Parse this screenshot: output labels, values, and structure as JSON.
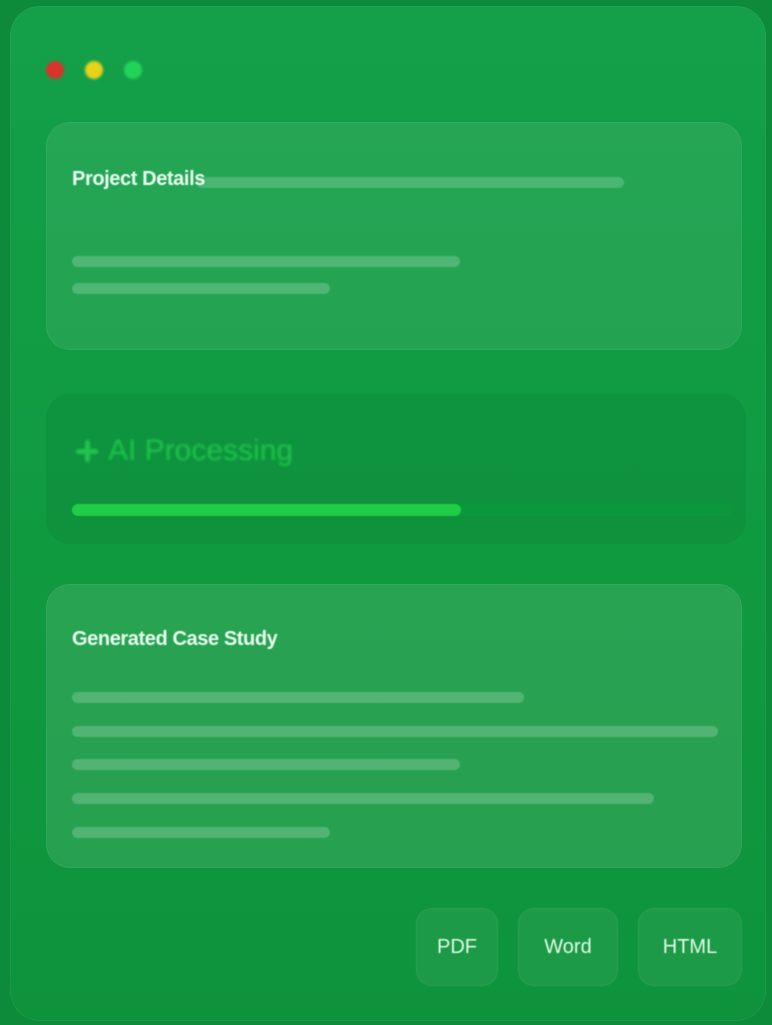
{
  "window": {
    "controls": [
      {
        "name": "close",
        "color": "#d8342a"
      },
      {
        "name": "minimize",
        "color": "#e6d21a"
      },
      {
        "name": "maximize",
        "color": "#22d35a"
      }
    ]
  },
  "project_details": {
    "title": "Project Details"
  },
  "processing": {
    "label": "AI Processing",
    "icon": "sparkle-icon",
    "progress": 0.59
  },
  "case_study": {
    "title": "Generated Case Study"
  },
  "export": {
    "buttons": [
      {
        "id": "pdf",
        "label": "PDF"
      },
      {
        "id": "word",
        "label": "Word"
      },
      {
        "id": "html",
        "label": "HTML"
      }
    ]
  }
}
